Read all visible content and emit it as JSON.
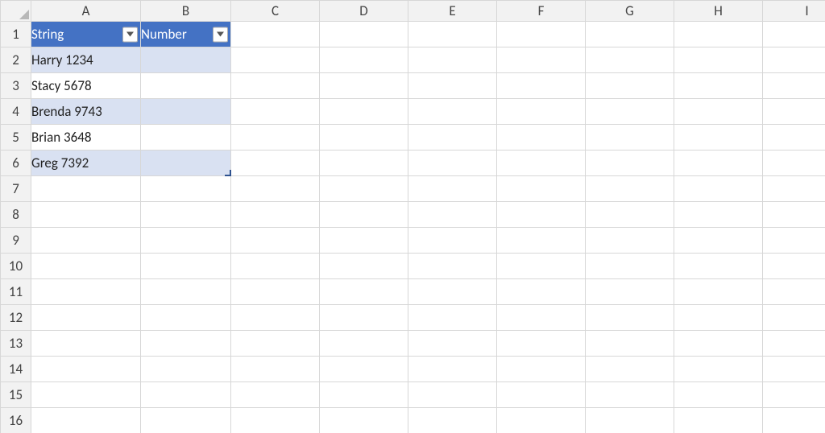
{
  "columns": [
    "A",
    "B",
    "C",
    "D",
    "E",
    "F",
    "G",
    "H",
    "I"
  ],
  "rows": [
    "1",
    "2",
    "3",
    "4",
    "5",
    "6",
    "7",
    "8",
    "9",
    "10",
    "11",
    "12",
    "13",
    "14",
    "15",
    "16"
  ],
  "table": {
    "headers": {
      "A": "String",
      "B": "Number"
    },
    "data": [
      {
        "A": "Harry 1234",
        "B": ""
      },
      {
        "A": "Stacy 5678",
        "B": ""
      },
      {
        "A": "Brenda 9743",
        "B": ""
      },
      {
        "A": "Brian 3648",
        "B": ""
      },
      {
        "A": "Greg 7392",
        "B": ""
      }
    ]
  },
  "colors": {
    "header_fill": "#4472C4",
    "band_fill": "#D9E1F2"
  }
}
